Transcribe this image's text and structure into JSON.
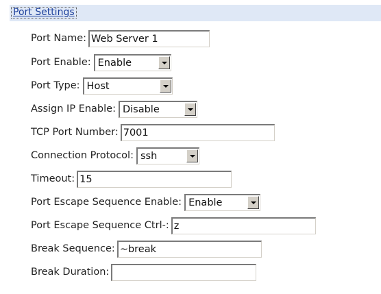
{
  "header": {
    "title": "Port Settings"
  },
  "fields": {
    "port_name": {
      "label": "Port Name:",
      "value": "Web Server 1"
    },
    "port_enable": {
      "label": "Port Enable:",
      "value": "Enable"
    },
    "port_type": {
      "label": "Port Type:",
      "value": "Host"
    },
    "assign_ip": {
      "label": "Assign IP Enable:",
      "value": "Disable"
    },
    "tcp_port": {
      "label": "TCP Port Number:",
      "value": "7001"
    },
    "protocol": {
      "label": "Connection Protocol:",
      "value": "ssh"
    },
    "timeout": {
      "label": "Timeout:",
      "value": "15"
    },
    "escape_enable": {
      "label": "Port Escape Sequence Enable:",
      "value": "Enable"
    },
    "escape_ctrl": {
      "label": "Port Escape Sequence Ctrl-:",
      "value": "z"
    },
    "break_sequence": {
      "label": "Break Sequence:",
      "value": "~break"
    },
    "break_duration": {
      "label": "Break Duration:",
      "value": ""
    }
  },
  "icons": {
    "dropdown": "chevron-down-icon"
  },
  "colors": {
    "header_bg": "#dfe8f6",
    "link": "#1c3f9b",
    "control_face": "#d4d0c8"
  }
}
